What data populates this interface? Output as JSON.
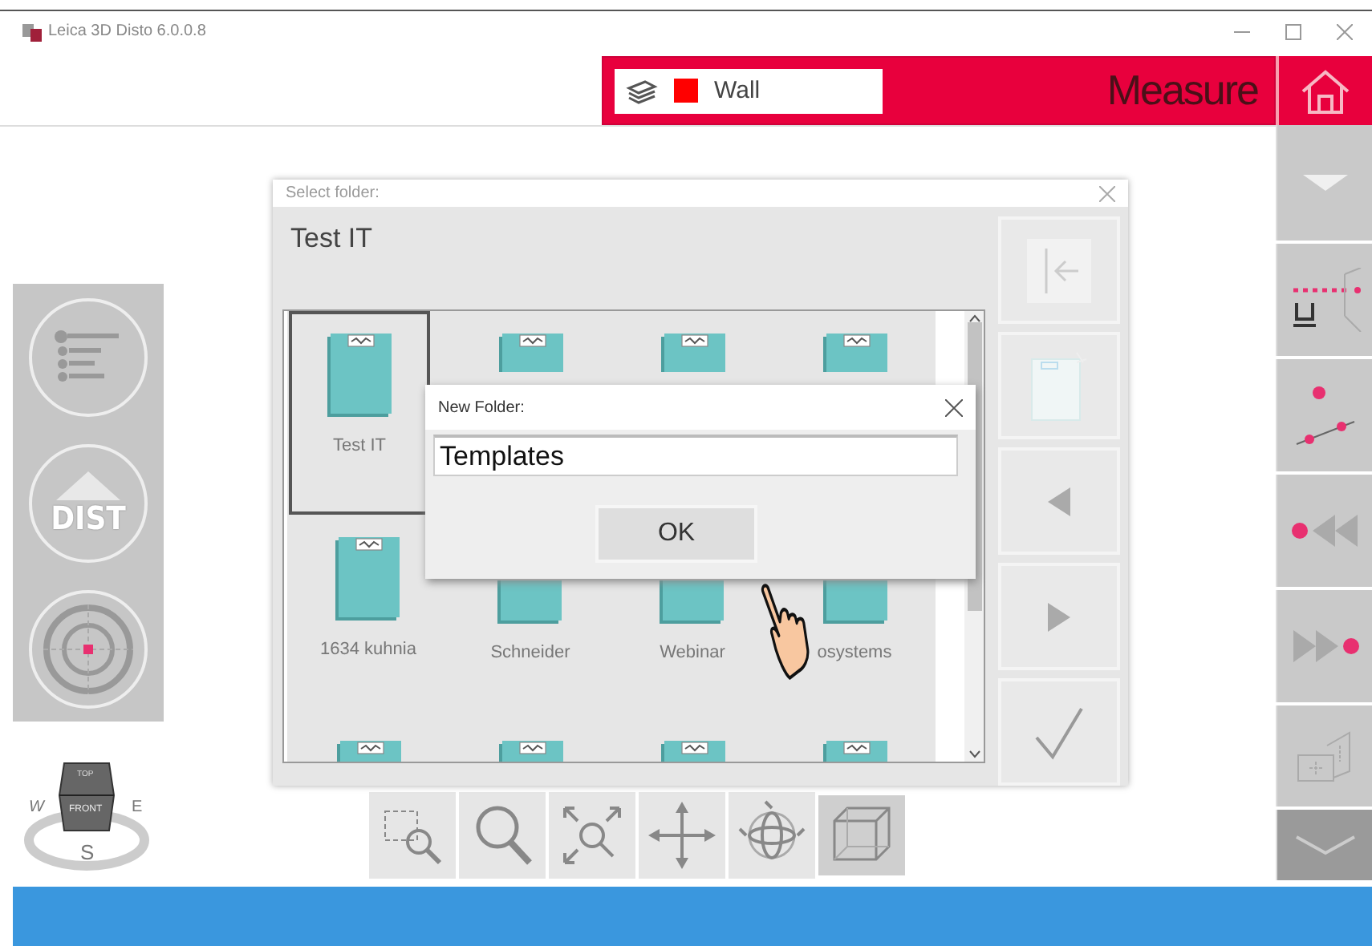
{
  "window": {
    "title": "Leica 3D Disto 6.0.0.8"
  },
  "header": {
    "layer": {
      "name": "Wall",
      "color": "#ff0000"
    },
    "mode": "Measure"
  },
  "left_panel": {
    "dist_label": "DIST"
  },
  "view_cube": {
    "top": "TOP",
    "front": "FRONT",
    "west": "W",
    "east": "E",
    "south": "S"
  },
  "select_folder": {
    "title": "Select folder:",
    "path": "Test IT",
    "folders": [
      {
        "name": "Test IT",
        "selected": true
      },
      {
        "selected": false
      },
      {
        "selected": false
      },
      {
        "selected": false
      },
      {
        "name": "1634 kuhnia",
        "selected": false
      },
      {
        "name": "Schneider",
        "selected": false
      },
      {
        "name": "Webinar",
        "selected": false
      },
      {
        "name": "osystems",
        "selected": false
      },
      {
        "selected": false
      },
      {
        "selected": false
      },
      {
        "selected": false
      },
      {
        "selected": false
      }
    ]
  },
  "new_folder": {
    "title": "New Folder:",
    "value": "Templates",
    "ok": "OK"
  },
  "view_toolbar": [
    {
      "kind": "zoom-window",
      "selected": false
    },
    {
      "kind": "zoom",
      "selected": false
    },
    {
      "kind": "zoom-extents",
      "selected": false
    },
    {
      "kind": "pan",
      "selected": false
    },
    {
      "kind": "orbit",
      "selected": false
    },
    {
      "kind": "box",
      "selected": true
    }
  ]
}
